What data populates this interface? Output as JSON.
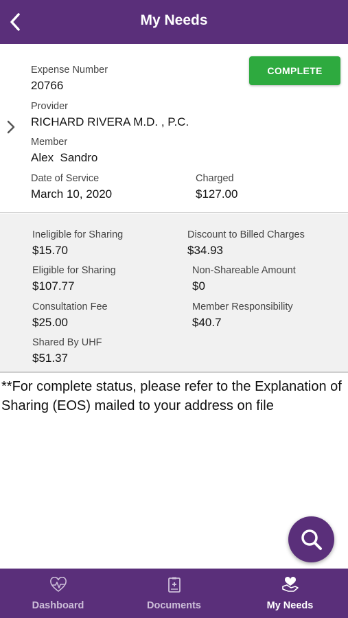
{
  "header": {
    "title": "My Needs"
  },
  "expense": {
    "status_label": "COMPLETE",
    "expense_number_label": "Expense Number",
    "expense_number": "20766",
    "provider_label": "Provider",
    "provider": "RICHARD RIVERA M.D. , P.C.",
    "member_label": "Member",
    "member": "Alex  Sandro",
    "date_label": "Date of Service",
    "date": "March 10, 2020",
    "charged_label": "Charged",
    "charged": "$127.00"
  },
  "summary": {
    "ineligible_label": "Ineligible for Sharing",
    "ineligible": "$15.70",
    "discount_label": "Discount to Billed Charges",
    "discount": "$34.93",
    "eligible_label": "Eligible for Sharing",
    "eligible": "$107.77",
    "nonshare_label": "Non-Shareable Amount",
    "nonshare": "$0",
    "consult_label": "Consultation Fee",
    "consult": "$25.00",
    "responsibility_label": "Member Responsibility",
    "responsibility": "$40.7",
    "shared_label": "Shared By UHF",
    "shared": "$51.37"
  },
  "note": "**For complete status, please refer to the Explanation of Sharing (EOS) mailed to your address on file",
  "tabs": [
    {
      "label": "Dashboard",
      "icon": "heart-pulse-icon"
    },
    {
      "label": "Documents",
      "icon": "document-icon"
    },
    {
      "label": "My Needs",
      "icon": "heart-hands-icon"
    }
  ],
  "colors": {
    "brand": "#5a2f7a",
    "status_complete": "#2eaa3f",
    "summary_bg": "#f1f1f1"
  }
}
